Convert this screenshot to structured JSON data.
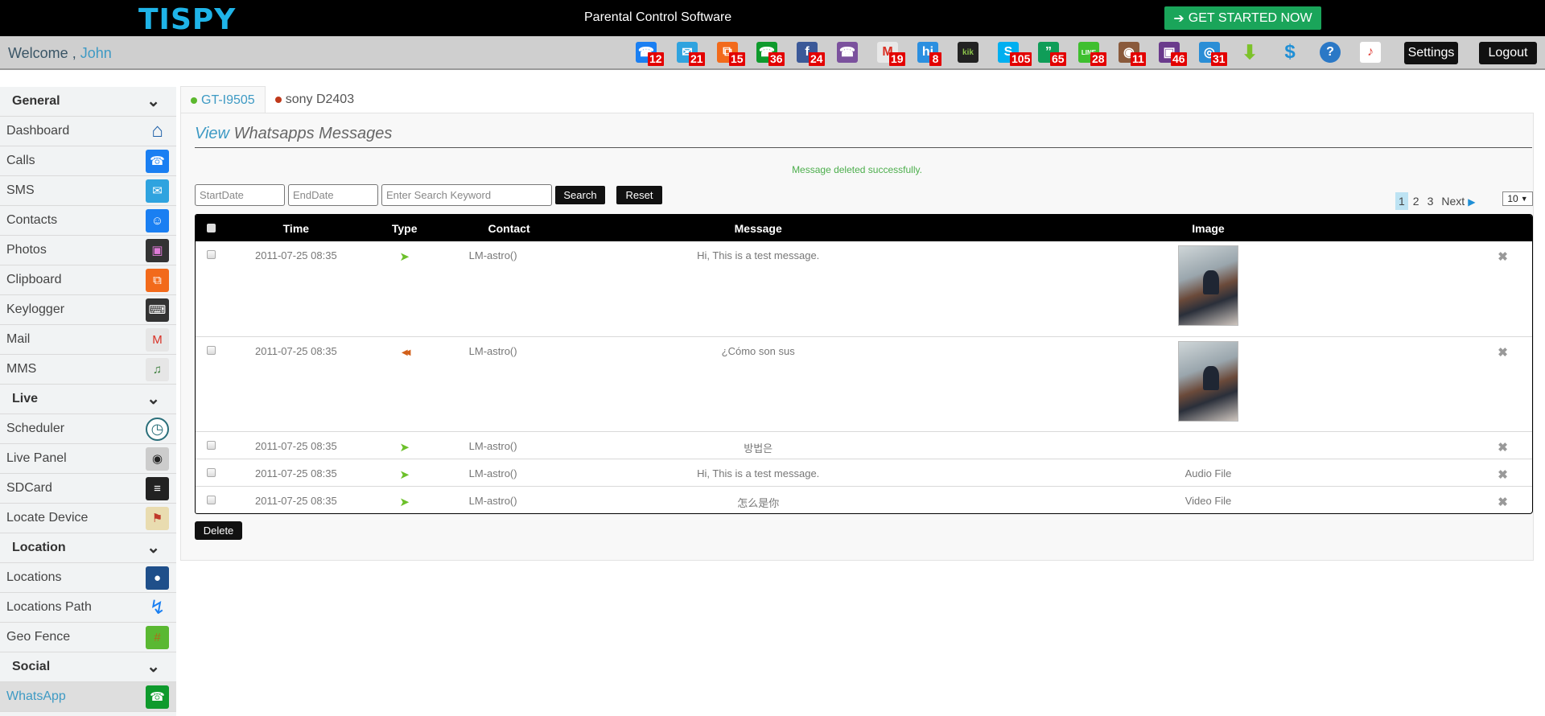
{
  "header": {
    "logo": "TISPY",
    "tagline": "Parental Control Software",
    "cta_label": "GET STARTED NOW",
    "cta_icon": "sign-in-icon"
  },
  "welcome": {
    "prefix": "Welcome ,",
    "user": "John"
  },
  "toolbar_icons": [
    {
      "name": "calls-icon",
      "badge": "12",
      "color": "#1a7ff2"
    },
    {
      "name": "sms-icon",
      "badge": "21",
      "color": "#2fa3df"
    },
    {
      "name": "clipboard-icon",
      "badge": "15",
      "color": "#f26a1b"
    },
    {
      "name": "whatsapp-icon",
      "badge": "36",
      "color": "#0e9a2c"
    },
    {
      "name": "facebook-icon",
      "badge": "24",
      "color": "#3b5998"
    },
    {
      "name": "viber-icon",
      "badge": "",
      "color": "#7b519d"
    },
    {
      "name": "gmail-icon",
      "badge": "19",
      "color": "#e8e8e8"
    },
    {
      "name": "hike-icon",
      "badge": "8",
      "color": "#2b8fe0"
    },
    {
      "name": "kik-icon",
      "badge": "",
      "color": "#222222"
    },
    {
      "name": "skype-icon",
      "badge": "105",
      "color": "#00aff0"
    },
    {
      "name": "hangouts-icon",
      "badge": "65",
      "color": "#0f9d58"
    },
    {
      "name": "line-icon",
      "badge": "28",
      "color": "#3fbf2f"
    },
    {
      "name": "instagram-icon",
      "badge": "11",
      "color": "#8a5a3c"
    },
    {
      "name": "photos-icon",
      "badge": "46",
      "color": "#6a3a8c"
    },
    {
      "name": "browser-icon",
      "badge": "31",
      "color": "#2a8ed6"
    },
    {
      "name": "download-icon",
      "badge": "",
      "color": "#7cc22a"
    },
    {
      "name": "pricing-icon",
      "badge": "",
      "color": "#1f8fd6"
    },
    {
      "name": "help-icon",
      "badge": "",
      "color": "#2a78c6"
    },
    {
      "name": "alerts-icon",
      "badge": "",
      "color": "#ffffff"
    }
  ],
  "toolbar_buttons": {
    "settings": "Settings",
    "logout": "Logout"
  },
  "sidebar": {
    "sections": [
      {
        "label": "General",
        "items": [
          {
            "label": "Dashboard",
            "icon": "home-icon"
          },
          {
            "label": "Calls",
            "icon": "phone-icon"
          },
          {
            "label": "SMS",
            "icon": "envelope-icon"
          },
          {
            "label": "Contacts",
            "icon": "contacts-icon"
          },
          {
            "label": "Photos",
            "icon": "photos-icon"
          },
          {
            "label": "Clipboard",
            "icon": "clipboard-icon"
          },
          {
            "label": "Keylogger",
            "icon": "keyboard-icon"
          },
          {
            "label": "Mail",
            "icon": "gmail-icon"
          },
          {
            "label": "MMS",
            "icon": "mms-icon"
          }
        ]
      },
      {
        "label": "Live",
        "items": [
          {
            "label": "Scheduler",
            "icon": "clock-icon"
          },
          {
            "label": "Live Panel",
            "icon": "camera-icon"
          },
          {
            "label": "SDCard",
            "icon": "sdcard-icon"
          },
          {
            "label": "Locate Device",
            "icon": "map-pin-icon"
          }
        ]
      },
      {
        "label": "Location",
        "items": [
          {
            "label": "Locations",
            "icon": "location-marker-icon"
          },
          {
            "label": "Locations Path",
            "icon": "path-icon"
          },
          {
            "label": "Geo Fence",
            "icon": "fence-icon"
          }
        ]
      },
      {
        "label": "Social",
        "items": [
          {
            "label": "WhatsApp",
            "icon": "whatsapp-icon",
            "active": true
          }
        ]
      }
    ]
  },
  "devices": [
    {
      "label": "GT-I9505",
      "status_color": "#5cb82e",
      "active": true
    },
    {
      "label": "sony D2403",
      "status_color": "#c0391b",
      "active": false
    }
  ],
  "page": {
    "title_prefix": "View",
    "title_rest": "Whatsapps Messages",
    "alert": "Message deleted successfully."
  },
  "filters": {
    "start_placeholder": "StartDate",
    "end_placeholder": "EndDate",
    "keyword_placeholder": "Enter Search Keyword",
    "search_label": "Search",
    "reset_label": "Reset"
  },
  "pagination": {
    "pages": [
      "1",
      "2",
      "3"
    ],
    "current": "1",
    "next_label": "Next",
    "per_page": "10"
  },
  "table": {
    "columns": [
      "",
      "Time",
      "Type",
      "Contact",
      "Message",
      "Image",
      ""
    ],
    "rows": [
      {
        "time": "2011-07-25 08:35",
        "type": "outgoing",
        "contact": "LM-astro()",
        "message": "Hi, This is a test message.",
        "image": "thumbnail",
        "image_text": ""
      },
      {
        "time": "2011-07-25 08:35",
        "type": "incoming",
        "contact": "LM-astro()",
        "message": "¿Cómo son sus",
        "image": "thumbnail",
        "image_text": ""
      },
      {
        "time": "2011-07-25 08:35",
        "type": "outgoing",
        "contact": "LM-astro()",
        "message": "방법은",
        "image": "",
        "image_text": ""
      },
      {
        "time": "2011-07-25 08:35",
        "type": "outgoing",
        "contact": "LM-astro()",
        "message": "Hi, This is a test message.",
        "image": "",
        "image_text": "Audio File"
      },
      {
        "time": "2011-07-25 08:35",
        "type": "outgoing",
        "contact": "LM-astro()",
        "message": "怎么是你",
        "image": "",
        "image_text": "Video File"
      }
    ],
    "delete_label": "Delete"
  }
}
